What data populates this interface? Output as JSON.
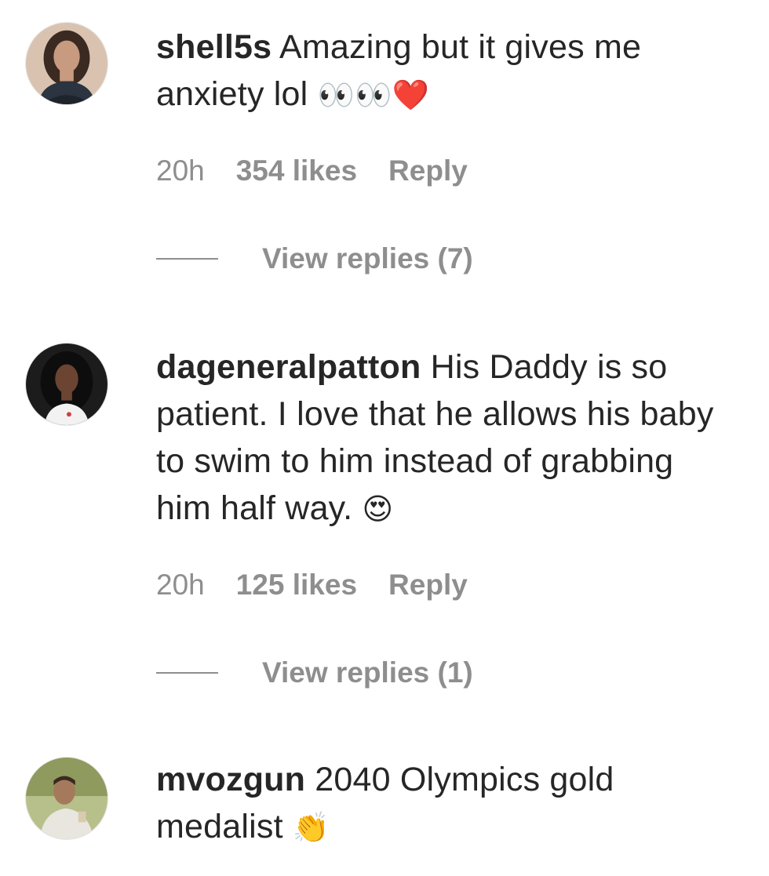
{
  "comments": [
    {
      "username": "shell5s",
      "text": "Amazing but it gives me anxiety lol",
      "emoji": "👀👀❤️",
      "time": "20h",
      "likes": "354 likes",
      "reply_label": "Reply",
      "view_replies": "View replies (7)"
    },
    {
      "username": "dageneralpatton",
      "text": "His Daddy is so patient. I love that he allows his baby to swim to him instead of grabbing him half way.",
      "emoji": "😍",
      "time": "20h",
      "likes": "125 likes",
      "reply_label": "Reply",
      "view_replies": "View replies (1)"
    },
    {
      "username": "mvozgun",
      "text": "2040 Olympics gold medalist",
      "emoji": "👏"
    }
  ]
}
